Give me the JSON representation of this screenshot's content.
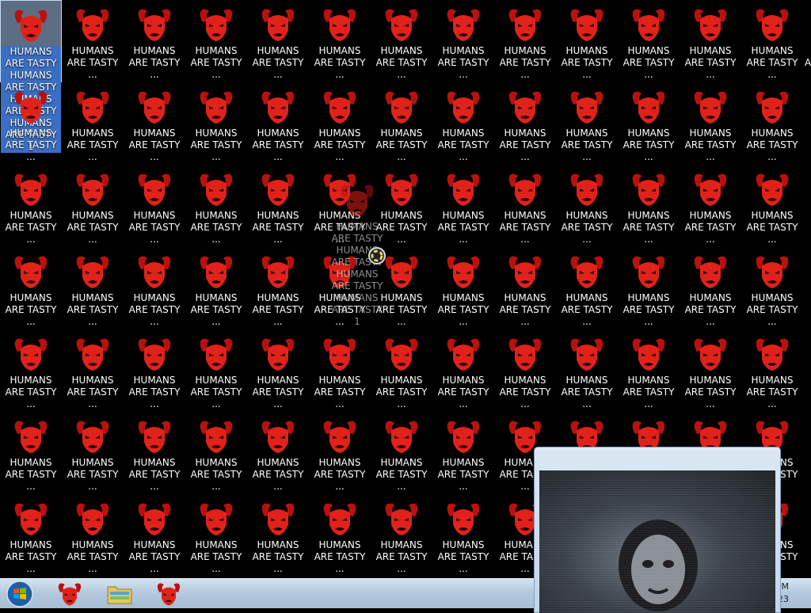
{
  "desktop": {
    "icon_label": "HUMANS ARE TASTY ...",
    "icon_label_short": "HUMANS ARE TASTY",
    "selected_label": "HUMANS ARE TASTY HUMANS ARE TASTY HUMANS ARE TASTY HUMANS ARE TASTY 1",
    "dragging_label": "HUMANS ARE TASTY HUMANS ARE TASTY HUMANS ARE TASTY HUMANS ARE TASTY 1",
    "edge_fragment": "A",
    "columns": 13,
    "rows": 7
  },
  "taskbar": {
    "items": [
      "demon-app-icon",
      "explorer-icon",
      "demon-app-icon"
    ],
    "clock_fragment": "M",
    "date_fragment": "23"
  },
  "popup": {
    "content": "video-frame"
  },
  "colors": {
    "icon_red": "#e0221a",
    "taskbar": "#b3c8dc",
    "selection": "#3a6fc4"
  }
}
